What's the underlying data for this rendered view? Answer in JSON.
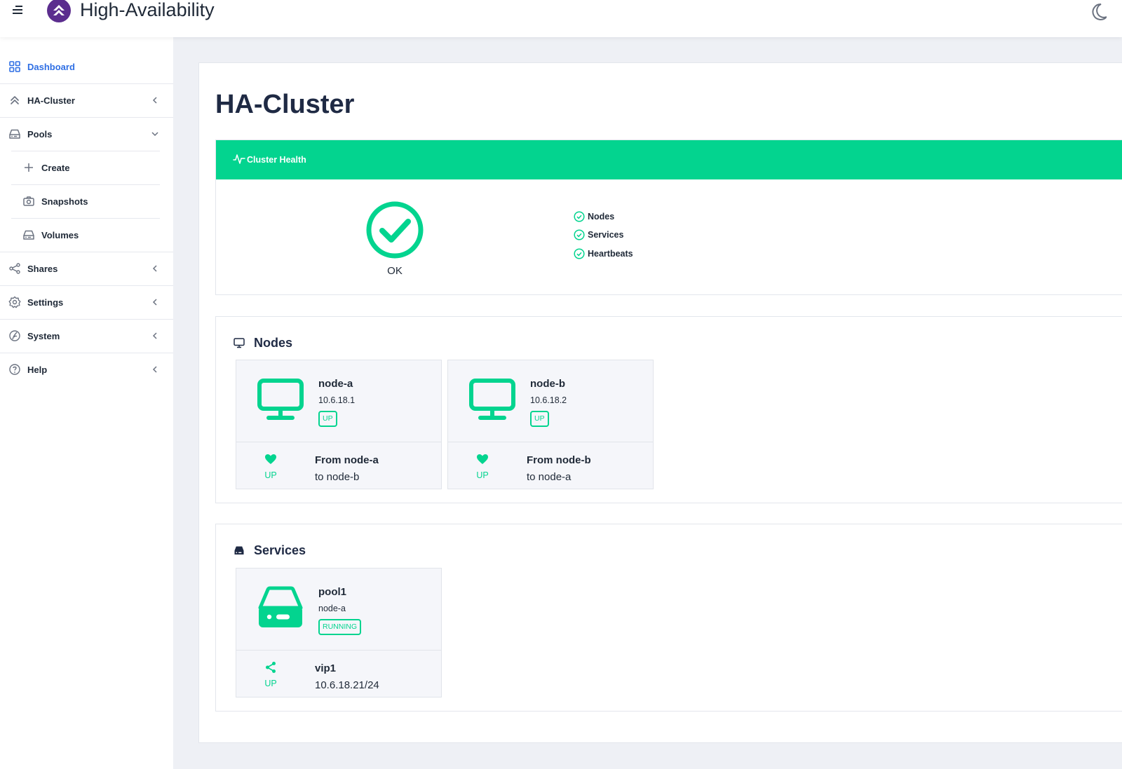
{
  "header": {
    "app_title": "High-Availability",
    "menu_icon": "hamburger-icon",
    "logo_icon": "brand-logo",
    "theme_icon": "moon-icon"
  },
  "sidebar": {
    "items": [
      {
        "label": "Dashboard",
        "icon": "dashboard-grid-icon",
        "active": true
      },
      {
        "label": "HA-Cluster",
        "icon": "chevrons-up-icon",
        "chevron": "chevron-left"
      },
      {
        "label": "Pools",
        "icon": "hard-drive-icon",
        "chevron": "chevron-down"
      },
      {
        "label": "Create",
        "icon": "plus-icon"
      },
      {
        "label": "Snapshots",
        "icon": "camera-icon"
      },
      {
        "label": "Volumes",
        "icon": "hard-drive-icon"
      },
      {
        "label": "Shares",
        "icon": "share-icon",
        "chevron": "chevron-left"
      },
      {
        "label": "Settings",
        "icon": "gear-icon",
        "chevron": "chevron-left"
      },
      {
        "label": "System",
        "icon": "system-icon",
        "chevron": "chevron-left"
      },
      {
        "label": "Help",
        "icon": "help-circle-icon",
        "chevron": "chevron-left"
      }
    ]
  },
  "main": {
    "title": "HA-Cluster",
    "health": {
      "header": "Cluster Health",
      "status": "OK",
      "checks": [
        "Nodes",
        "Services",
        "Heartbeats"
      ]
    },
    "nodes": {
      "title": "Nodes",
      "items": [
        {
          "name": "node-a",
          "ip": "10.6.18.1",
          "badge": "UP",
          "heartbeat_state": "UP",
          "from": "From node-a",
          "to": "to node-b"
        },
        {
          "name": "node-b",
          "ip": "10.6.18.2",
          "badge": "UP",
          "heartbeat_state": "UP",
          "from": "From node-b",
          "to": "to node-a"
        }
      ]
    },
    "services": {
      "title": "Services",
      "items": [
        {
          "name": "pool1",
          "node": "node-a",
          "badge": "RUNNING",
          "vip_state": "UP",
          "vip_name": "vip1",
          "vip_addr": "10.6.18.21/24"
        }
      ]
    }
  },
  "colors": {
    "accent": "#03d48f",
    "active_link": "#2f6fe4",
    "logo": "#5b2d8e",
    "text": "#1f2937"
  }
}
